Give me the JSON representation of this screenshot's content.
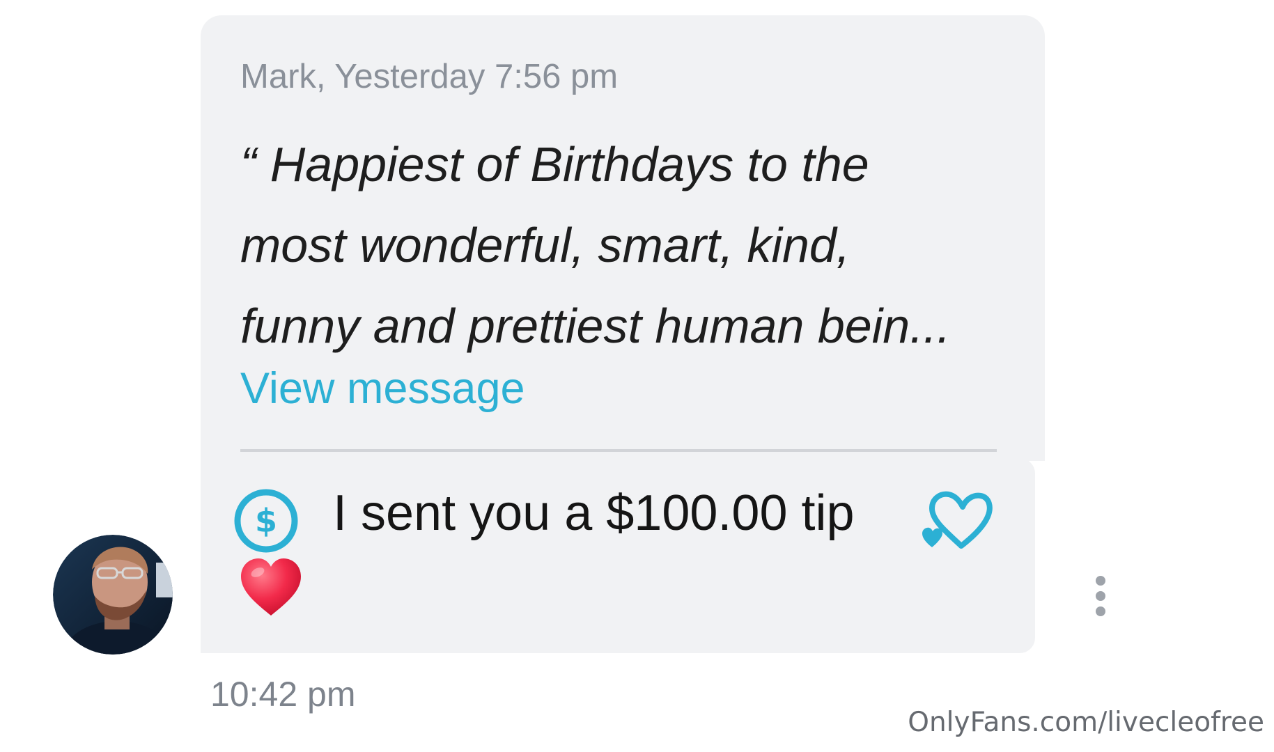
{
  "quoted_message": {
    "meta": "Mark, Yesterday 7:56 pm",
    "lines": [
      "“ Happiest of Birthdays to the",
      "most wonderful, smart, kind,",
      "funny and prettiest human bein..."
    ],
    "link_label": "View message"
  },
  "tip": {
    "icon": "dollar-circle-icon",
    "text": "I sent you a $100.00 tip",
    "emoji": "❤️",
    "accent_color": "#2cb0d4"
  },
  "message": {
    "time": "10:42 pm"
  },
  "watermark": "OnlyFans.com/livecleofree"
}
